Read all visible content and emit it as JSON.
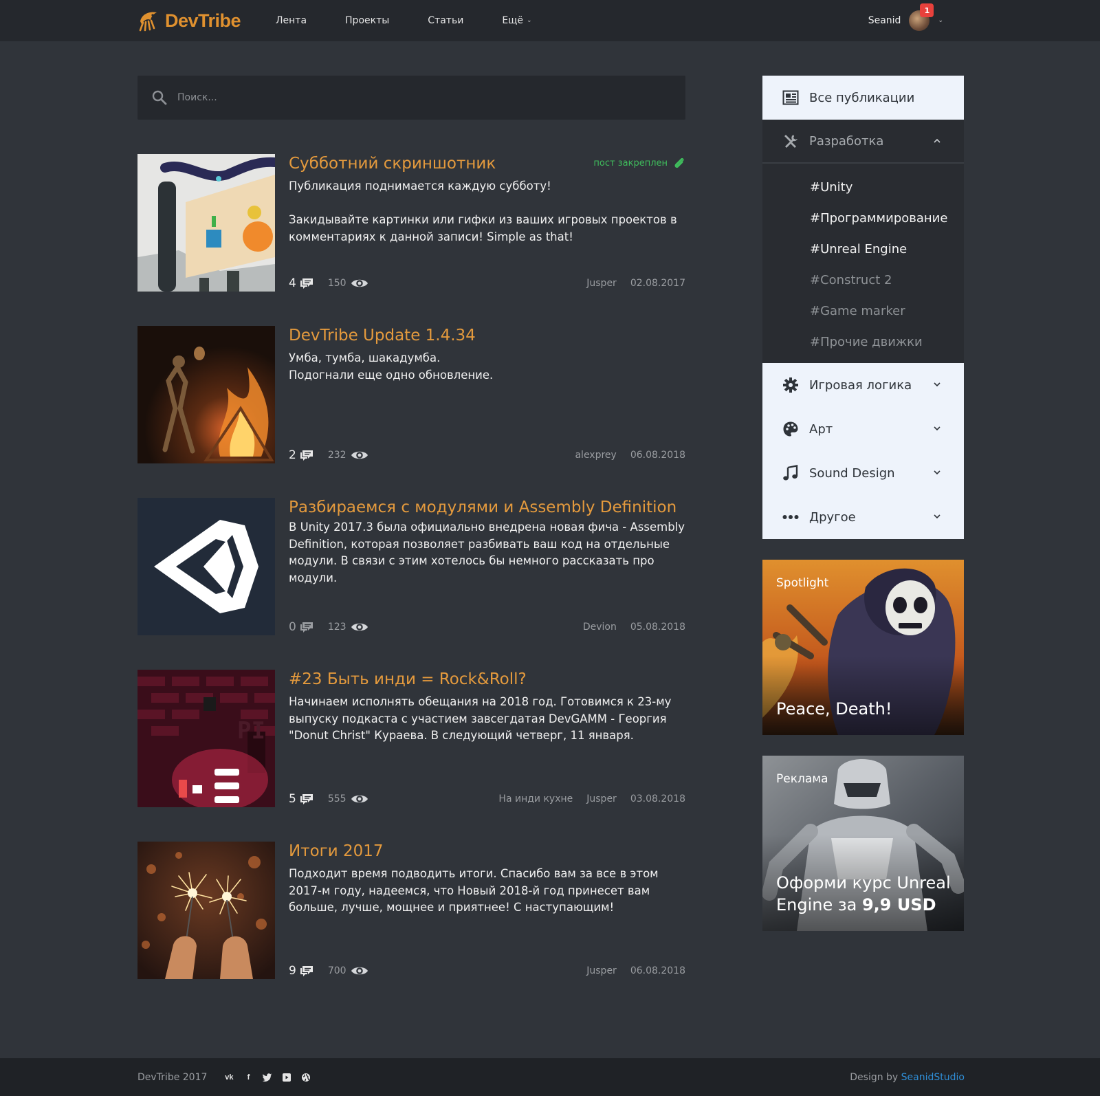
{
  "header": {
    "logo_text": "DevTribe",
    "nav": [
      "Лента",
      "Проекты",
      "Статьи",
      "Ещё"
    ],
    "user_name": "Seanid",
    "notifications": "1"
  },
  "search": {
    "placeholder": "Поиск..."
  },
  "posts": [
    {
      "title": "Субботний скриншотник",
      "pinned": "пост закреплен",
      "text": "Публикация поднимается каждую субботу!\n\nЗакидывайте картинки или гифки из ваших игровых проектов в комментариях к данной записи! Simple as that!",
      "comments": "4",
      "views": "150",
      "category": "",
      "author": "Jusper",
      "date": "02.08.2017"
    },
    {
      "title": "DevTribe Update 1.4.34",
      "text": "Умба, тумба, шакадумба.\nПодогнали еще одно обновление.",
      "comments": "2",
      "views": "232",
      "category": "",
      "author": "alexprey",
      "date": "06.08.2018"
    },
    {
      "title": "Разбираемся с модулями и Assembly Definition",
      "text": "В Unity 2017.3 была официально внедрена новая фича - Assembly Definition, которая позволяет разбивать ваш код на отдельные модули. В связи с этим хотелось бы немного рассказать про модули.",
      "comments": "0",
      "views": "123",
      "category": "",
      "author": "Devion",
      "date": "05.08.2018"
    },
    {
      "title": "#23 Быть инди = Rock&Roll?",
      "text": "Начинаем исполнять обещания на 2018 год. Готовимся к 23-му выпуску подкаста с участием завсегдатая DevGAMM - Георгия \"Donut Christ\" Кураева. В следующий четверг, 11 января.",
      "comments": "5",
      "views": "555",
      "category": "На инди кухне",
      "author": "Jusper",
      "date": "03.08.2018"
    },
    {
      "title": "Итоги 2017",
      "text": "Подходит время подводить итоги. Спасибо вам за все в этом 2017-м году, надеемся, что Новый 2018-й год принесет вам больше, лучше, мощнее и приятнее! С наступающим!",
      "comments": "9",
      "views": "700",
      "category": "",
      "author": "Jusper",
      "date": "06.08.2018"
    }
  ],
  "sidebar": {
    "all": "Все публикации",
    "dev": "Разработка",
    "tags": [
      "#Unity",
      "#Программирование",
      "#Unreal Engine",
      "#Construct 2",
      "#Game marker",
      "#Прочие движки"
    ],
    "cats": [
      "Игровая логика",
      "Арт",
      "Sound Design",
      "Другое"
    ],
    "spotlight": {
      "label": "Spotlight",
      "title": "Peace, Death!"
    },
    "ad": {
      "label": "Реклама",
      "title": "Оформи курс Unreal Engine за ",
      "price": "9,9 USD"
    }
  },
  "footer": {
    "copyright": "DevTribe 2017",
    "design_by": "Design by ",
    "studio": "SeanidStudio"
  },
  "colors": {
    "accent": "#e49a3d",
    "pinned": "#3fbc5c",
    "link": "#2f8ed6",
    "badge": "#e8413c"
  }
}
